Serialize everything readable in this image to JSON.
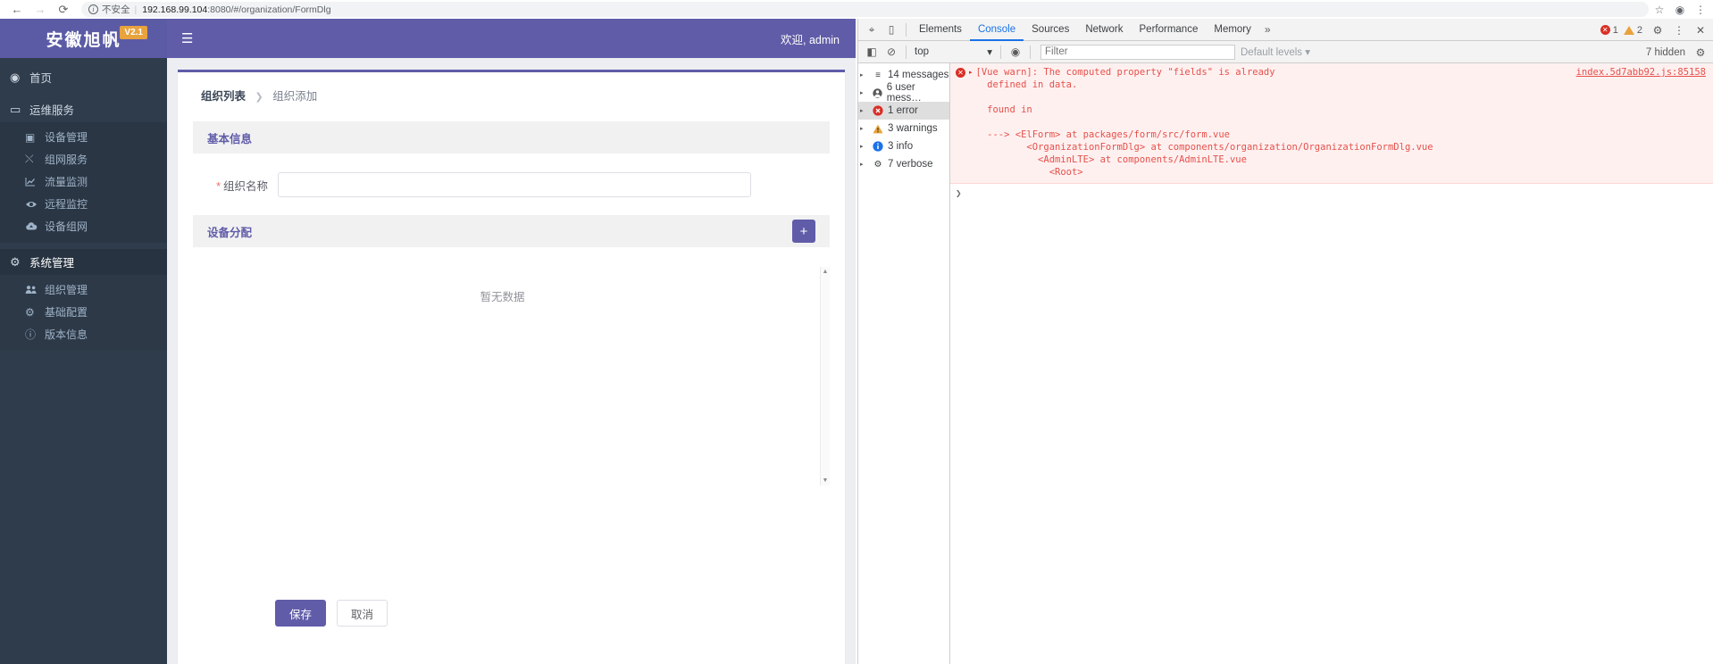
{
  "browser": {
    "back_icon": "←",
    "forward_icon": "→",
    "reload_icon": "⟳",
    "info_icon": "i",
    "security_label": "不安全",
    "url_host": "192.168.99.104",
    "url_rest": ":8080/#/organization/FormDlg",
    "star_icon": "☆",
    "profile_icon": "◉",
    "menu_icon": "⋮"
  },
  "app": {
    "brand": {
      "name": "安徽旭帆",
      "version_badge": "V2.1"
    },
    "topbar": {
      "hamburger_icon": "☰",
      "welcome": "欢迎, admin"
    },
    "sidebar": {
      "items": [
        {
          "label": "首页",
          "icon": "◉",
          "level": "top",
          "active": false
        },
        {
          "label": "运维服务",
          "icon": "▭",
          "level": "top",
          "active": false
        },
        {
          "label": "设备管理",
          "icon": "▣",
          "level": "sub"
        },
        {
          "label": "组网服务",
          "icon": "⤬",
          "level": "sub"
        },
        {
          "label": "流量监测",
          "icon": "📈",
          "level": "sub"
        },
        {
          "label": "远程监控",
          "icon": "◉",
          "level": "sub"
        },
        {
          "label": "设备组网",
          "icon": "☁",
          "level": "sub"
        },
        {
          "label": "系统管理",
          "icon": "⚙",
          "level": "top",
          "active": true
        },
        {
          "label": "组织管理",
          "icon": "👥",
          "level": "sub"
        },
        {
          "label": "基础配置",
          "icon": "⚙",
          "level": "sub"
        },
        {
          "label": "版本信息",
          "icon": "ⓘ",
          "level": "sub"
        }
      ]
    },
    "breadcrumb": {
      "root": "组织列表",
      "separator": "❯",
      "current": "组织添加"
    },
    "basic_section": {
      "title": "基本信息"
    },
    "form": {
      "org_name_label": "组织名称",
      "org_name_required": "*",
      "org_name_value": "",
      "org_name_placeholder": ""
    },
    "device_section": {
      "title": "设备分配",
      "add_icon": "+"
    },
    "table": {
      "empty_text": "暂无数据",
      "scroll_up": "▲",
      "scroll_down": "▼"
    },
    "footer": {
      "save_label": "保存",
      "cancel_label": "取消"
    },
    "colors": {
      "brand_purple": "#605ca8",
      "sidebar_dark": "#2f3c4b",
      "badge_orange": "#e8a33d"
    }
  },
  "devtools": {
    "left_icons": {
      "inspect": "⌖",
      "device": "▯"
    },
    "tabs": [
      {
        "label": "Elements",
        "active": false
      },
      {
        "label": "Console",
        "active": true
      },
      {
        "label": "Sources",
        "active": false
      },
      {
        "label": "Network",
        "active": false
      },
      {
        "label": "Performance",
        "active": false
      },
      {
        "label": "Memory",
        "active": false
      }
    ],
    "more_icon": "»",
    "error_count": "1",
    "warning_count": "2",
    "settings_icon": "⚙",
    "kebab_icon": "⋮",
    "close_icon": "✕",
    "filterbar": {
      "sidebar_toggle_icon": "◧",
      "clear_icon": "⊘",
      "context": "top",
      "context_caret": "▾",
      "eye_icon": "◉",
      "filter_placeholder": "Filter",
      "levels": "Default levels",
      "levels_caret": "▾",
      "hidden_text": "7 hidden",
      "gear_icon": "⚙"
    },
    "sidebar_rows": [
      {
        "label": "14 messages",
        "icon": "≡",
        "selected": false
      },
      {
        "label": "6 user mess…",
        "icon": "◉",
        "selected": false
      },
      {
        "label": "1 error",
        "icon": "✕",
        "selected": true
      },
      {
        "label": "3 warnings",
        "icon": "⚠",
        "selected": false
      },
      {
        "label": "3 info",
        "icon": "ⓘ",
        "selected": false
      },
      {
        "label": "7 verbose",
        "icon": "⚙",
        "selected": false
      }
    ],
    "message": {
      "icon": "✕",
      "expand_caret": "▸",
      "text": "[Vue warn]: The computed property \"fields\" is already\n  defined in data.\n\n  found in\n\n  ---> <ElForm> at packages/form/src/form.vue\n         <OrganizationFormDlg> at components/organization/OrganizationFormDlg.vue\n           <AdminLTE> at components/AdminLTE.vue\n             <Root>",
      "source": "index.5d7abb92.js:85158"
    },
    "prompt_caret": "❯"
  }
}
